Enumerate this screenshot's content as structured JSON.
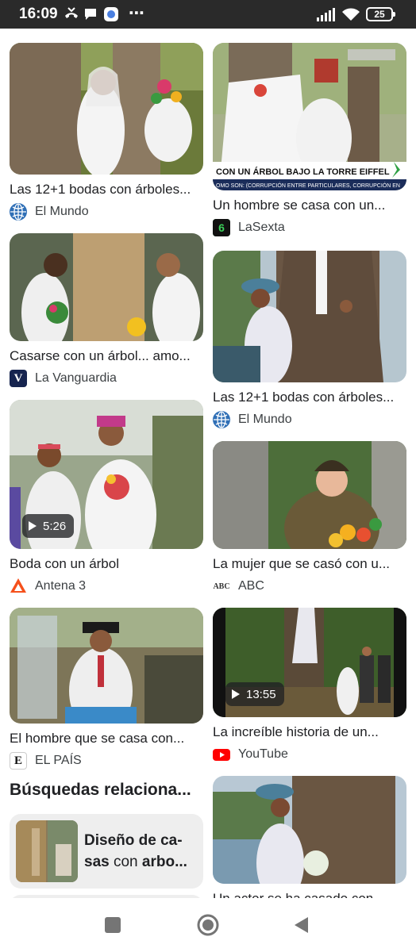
{
  "status_bar": {
    "time": "16:09",
    "overflow": "⋯",
    "battery": "25",
    "icons": [
      "missed-call-icon",
      "chat-bubble-icon",
      "app-notification-icon",
      "signal-icon",
      "wifi-icon",
      "battery-icon"
    ]
  },
  "results": [
    {
      "title": "Las 12+1 bodas con árboles...",
      "source": "El Mundo",
      "source_icon": "globe-icon",
      "duration": ""
    },
    {
      "title": "Un hombre se casa con un...",
      "source": "LaSexta",
      "source_icon": "lasexta-logo",
      "duration": "",
      "overlay_caption": "CON UN ÁRBOL BAJO LA TORRE EIFFEL",
      "overlay_ticker": "OMO SON: (CORRUPCIÓN ENTRE PARTICULARES, CORRUPCIÓN EN"
    },
    {
      "title": "Casarse con un árbol... amo...",
      "source": "La Vanguardia",
      "source_icon": "lavanguardia-logo",
      "source_letter": "V",
      "duration": ""
    },
    {
      "title": "Las 12+1 bodas con árboles...",
      "source": "El Mundo",
      "source_icon": "globe-icon",
      "duration": ""
    },
    {
      "title": "Boda con un árbol",
      "source": "Antena 3",
      "source_icon": "antena3-logo",
      "duration": "5:26"
    },
    {
      "title": "La mujer que se casó con u...",
      "source": "ABC",
      "source_icon": "abc-logo",
      "source_letter": "ABC",
      "duration": ""
    },
    {
      "title": "El hombre que se casa con...",
      "source": "EL PAÍS",
      "source_icon": "elpais-logo",
      "source_letter": "E",
      "duration": ""
    },
    {
      "title": "La increíble historia de un...",
      "source": "YouTube",
      "source_icon": "youtube-logo",
      "duration": "13:55"
    },
    {
      "title": "Un actor se ha casado con...",
      "source": "",
      "source_icon": "",
      "duration": ""
    }
  ],
  "related": {
    "heading": "Búsquedas relaciona...",
    "chip_text_bold1": "Diseño de ca-",
    "chip_text_bold2": "sas",
    "chip_text_normal": " con ",
    "chip_text_bold3": "arbo..."
  },
  "nav": {
    "buttons": [
      "recents-button",
      "home-button",
      "back-button"
    ]
  },
  "colors": {
    "status_bar_bg": "#2a2a2a",
    "lasexta_green": "#1a8f3c",
    "vanguardia_navy": "#16244f",
    "antena3_orange": "#f5501b",
    "youtube_red": "#ff0000",
    "elmundo_blue": "#2f6fb6",
    "chip_bg": "#eeeeee"
  }
}
